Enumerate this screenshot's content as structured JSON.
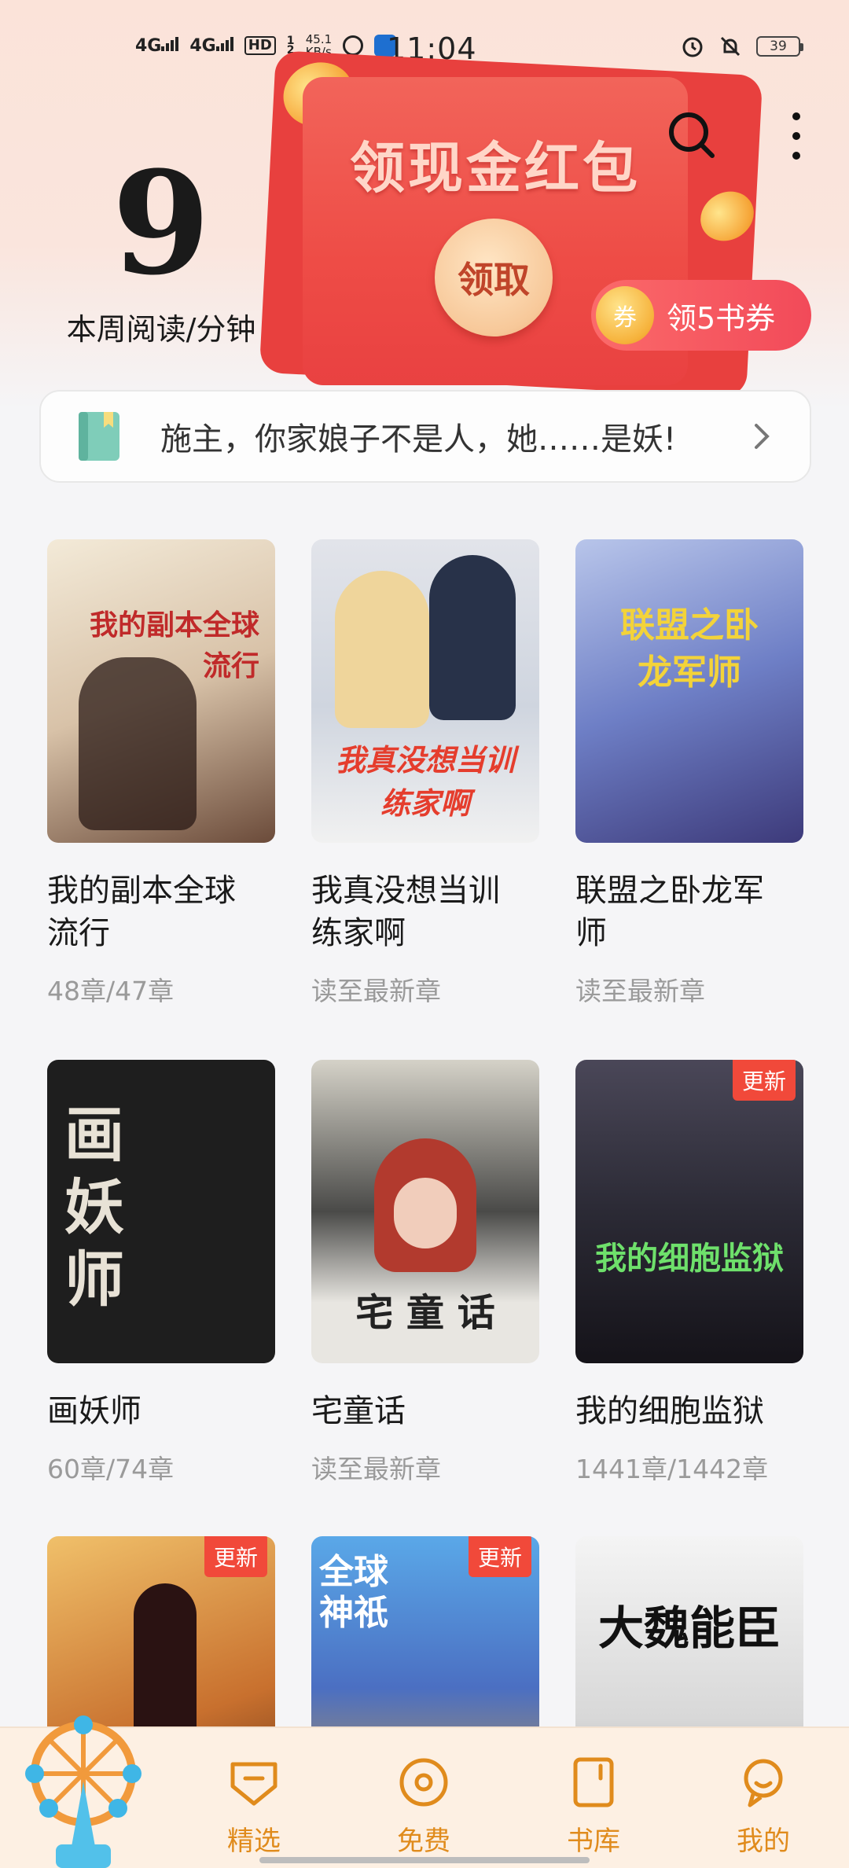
{
  "status_bar": {
    "network1": "4G",
    "network2": "4G",
    "hd_label": "HD",
    "hd_sub": "1 2",
    "speed_value": "45.1",
    "speed_unit": "KB/s",
    "time": "11:04",
    "battery": "39"
  },
  "header": {
    "reading_minutes": "9",
    "reading_label": "本周阅读/分钟",
    "banner_title": "领现金红包",
    "claim_label": "领取",
    "coupon_icon": "券",
    "coupon_label": "领5书券"
  },
  "notice": {
    "text": "施主，你家娘子不是人，她……是妖!"
  },
  "books": [
    {
      "title": "我的副本全球流行",
      "progress": "48章/47章",
      "cover_text": "我的副本全球流行",
      "updated": false
    },
    {
      "title": "我真没想当训练家啊",
      "progress": "读至最新章",
      "cover_text": "我真没想当训练家啊",
      "updated": false
    },
    {
      "title": "联盟之卧龙军师",
      "progress": "读至最新章",
      "cover_text": "联盟之卧龙军师",
      "updated": false
    },
    {
      "title": "画妖师",
      "progress": "60章/74章",
      "cover_text": "画妖师",
      "updated": false
    },
    {
      "title": "宅童话",
      "progress": "读至最新章",
      "cover_text": "宅 童 话",
      "updated": false
    },
    {
      "title": "我的细胞监狱",
      "progress": "1441章/1442章",
      "cover_text": "我的细胞监狱",
      "updated": true
    },
    {
      "title": "",
      "progress": "",
      "cover_text": "",
      "updated": true
    },
    {
      "title": "",
      "progress": "",
      "cover_text": "全球神祇",
      "updated": true
    },
    {
      "title": "",
      "progress": "",
      "cover_text": "大魏能臣",
      "updated": false
    }
  ],
  "update_badge": "更新",
  "tabs": [
    {
      "label": "精选"
    },
    {
      "label": "免费"
    },
    {
      "label": "书库"
    },
    {
      "label": "我的"
    }
  ],
  "colors": {
    "accent": "#e08b1c",
    "red_banner": "#ee4c46",
    "update_badge": "#f1493a"
  }
}
